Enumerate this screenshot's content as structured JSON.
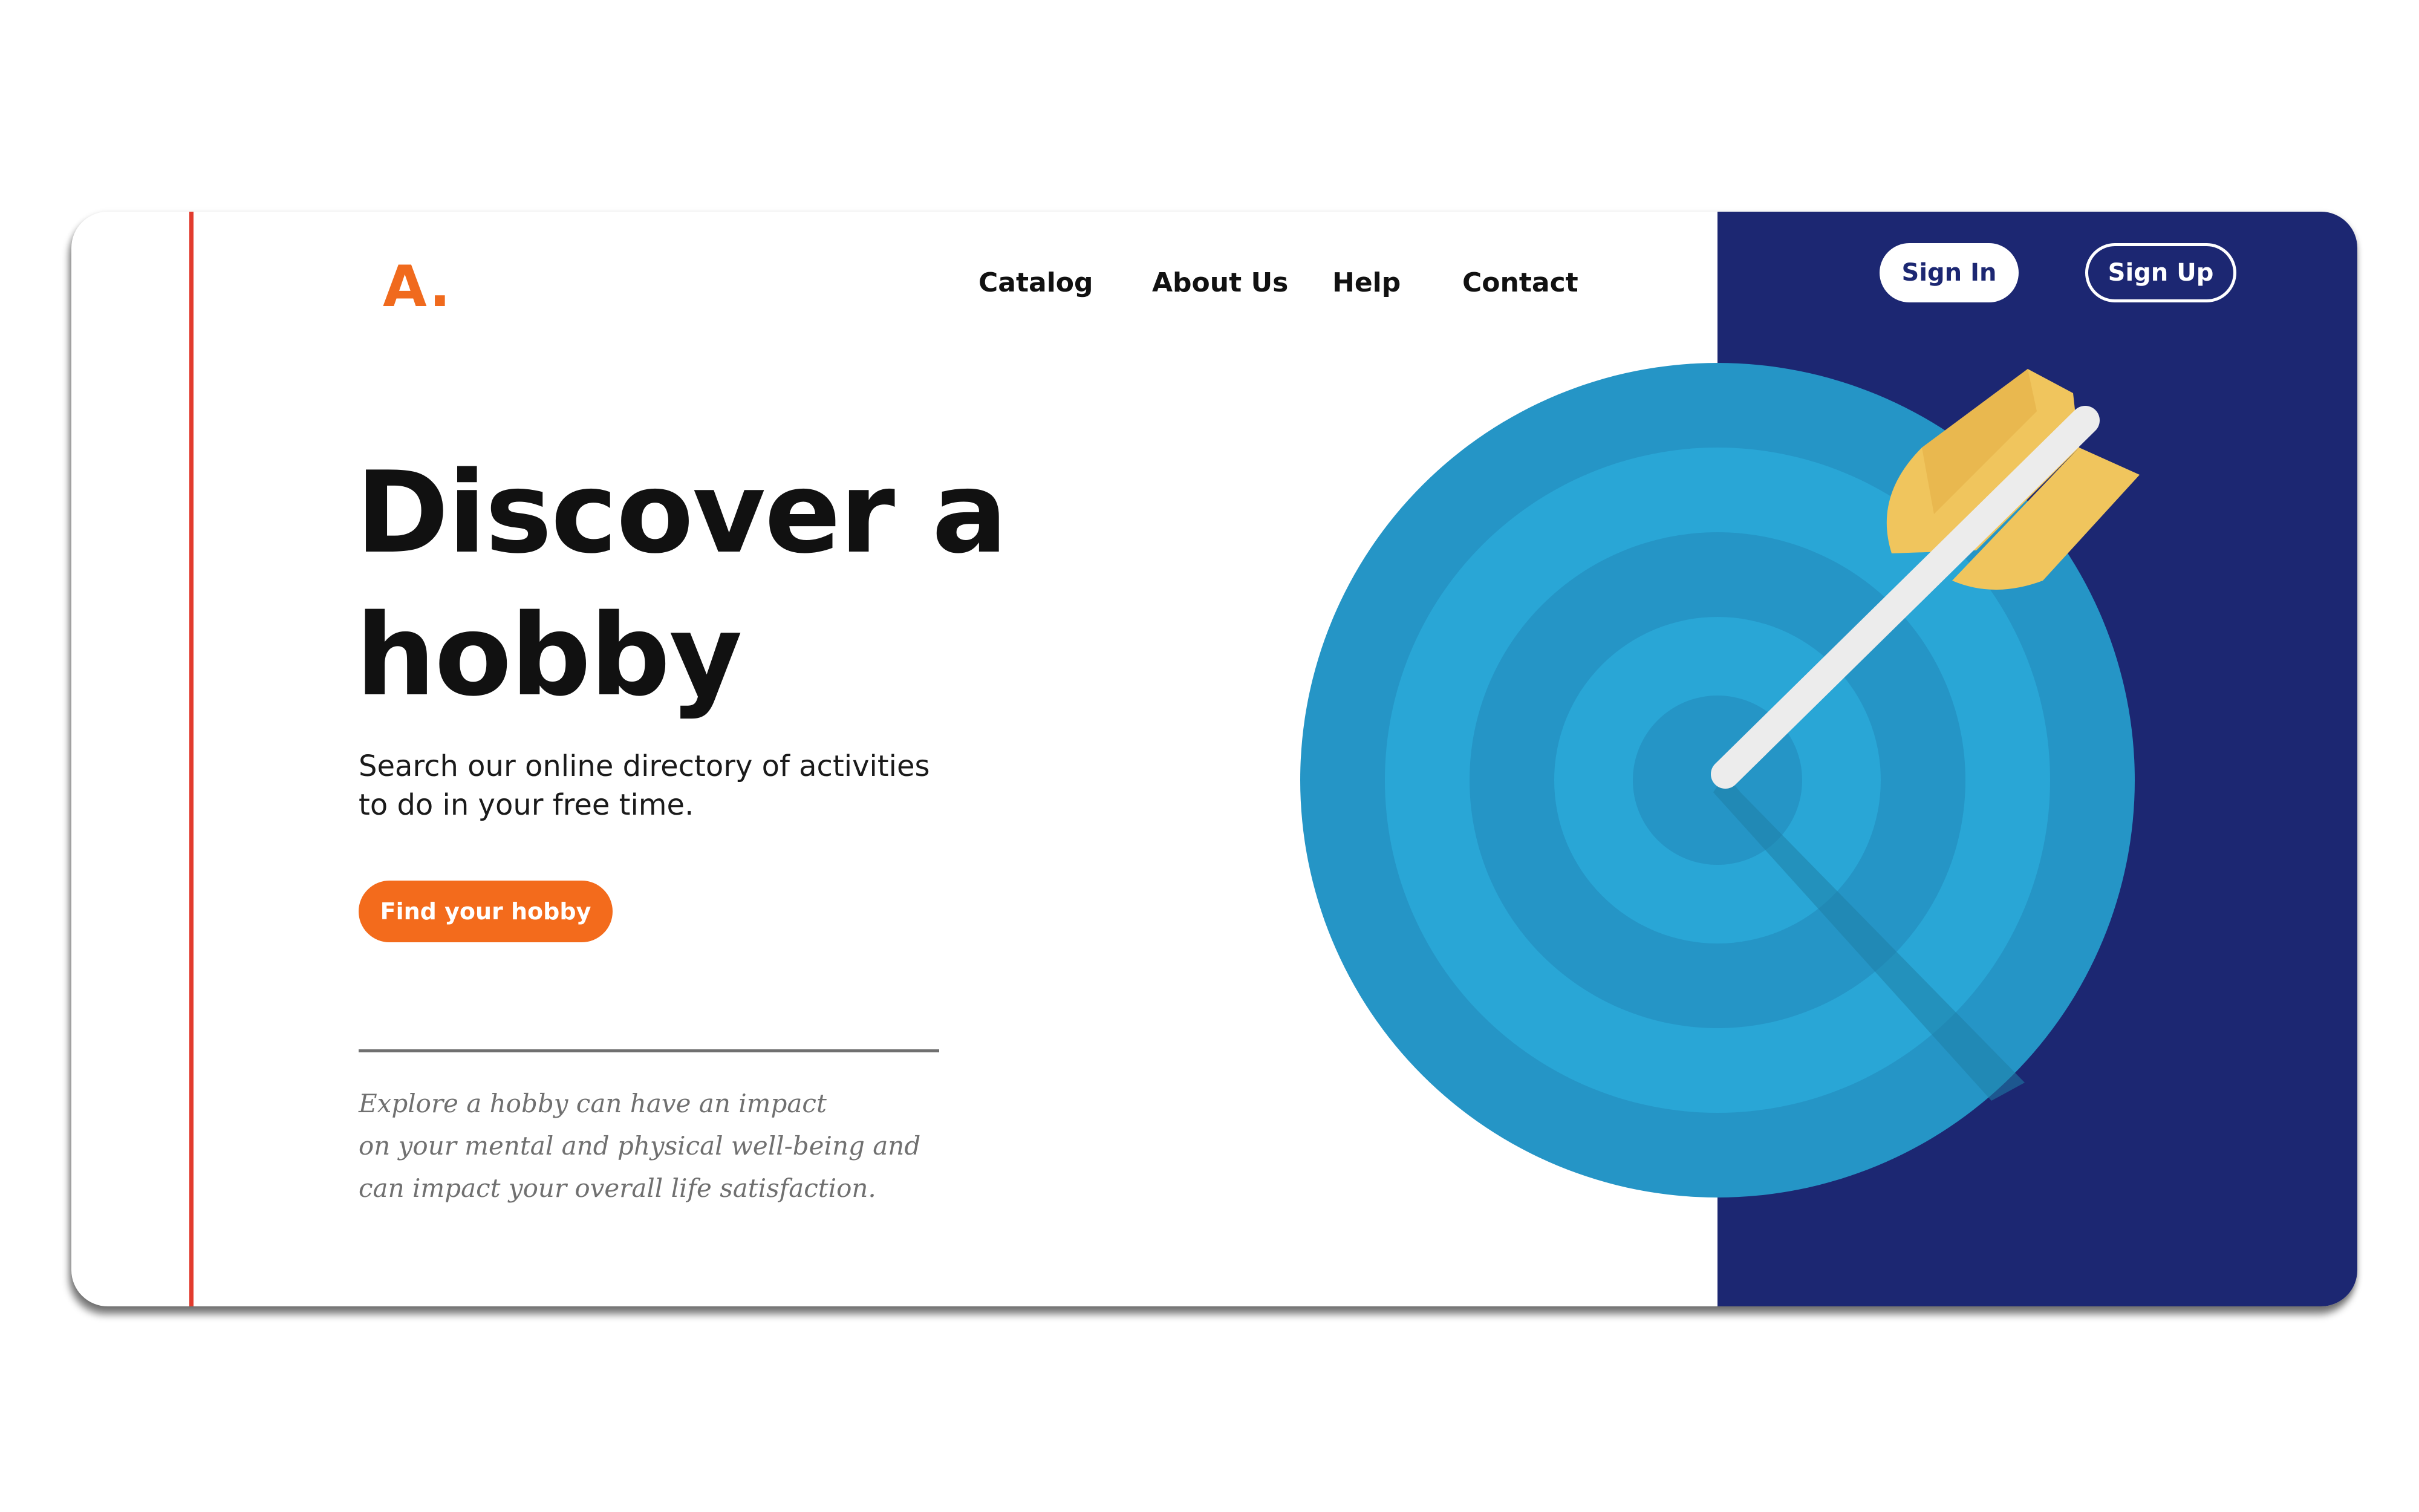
{
  "logo": {
    "text": "A."
  },
  "nav": {
    "items": [
      {
        "label": "Catalog"
      },
      {
        "label": "About Us"
      },
      {
        "label": "Help"
      },
      {
        "label": "Contact"
      }
    ]
  },
  "auth": {
    "sign_in": "Sign In",
    "sign_up": "Sign Up"
  },
  "hero": {
    "headline_line1": "Discover a",
    "headline_line2": "hobby",
    "subtext": "Search our online directory of activities to do in your free time.",
    "cta": "Find your hobby",
    "quote_line1": "Explore a hobby can have an impact",
    "quote_line2": "on your mental and physical well-being and",
    "quote_line3": "can impact your overall life satisfaction."
  },
  "colors": {
    "accent_orange": "#f36b1c",
    "navy": "#1c2772",
    "target_outer": "#2595c6",
    "target_inner": "#29a6d6",
    "arrow_feather": "#f0c55d",
    "divider_red": "#e23b2e"
  },
  "icons": {
    "illustration": "target-arrow-icon"
  }
}
